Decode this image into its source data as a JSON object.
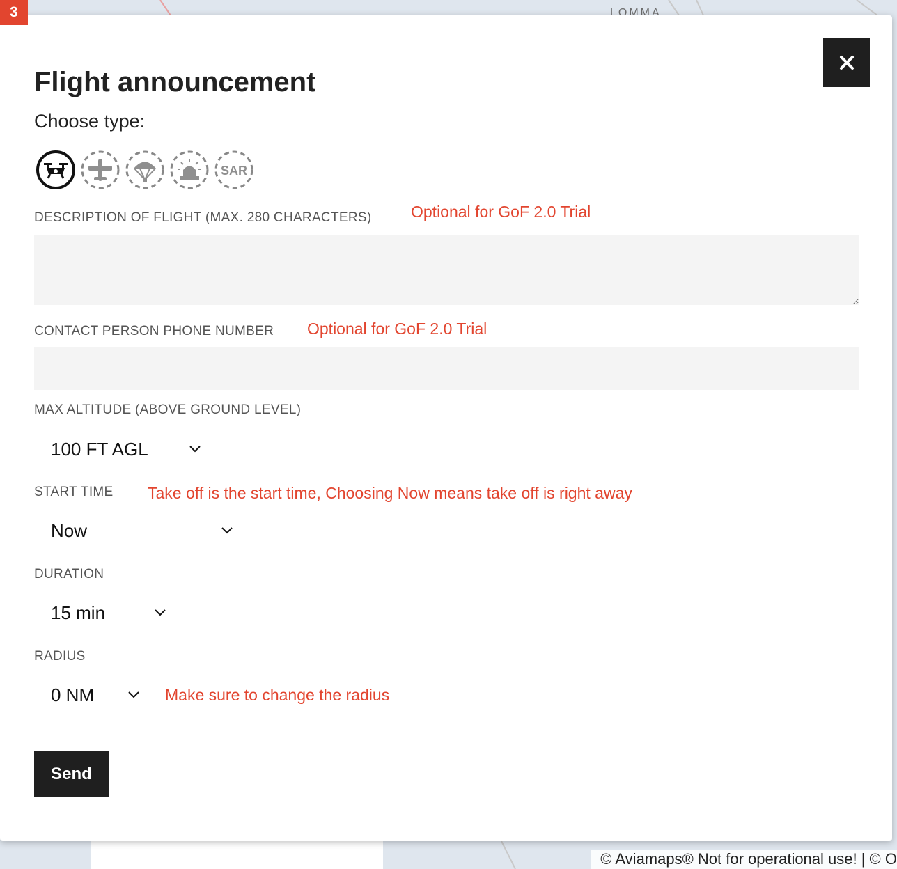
{
  "step_badge": "3",
  "map": {
    "place_label": "LOMMA",
    "attribution": "© Aviamaps® Not for operational use! | © O"
  },
  "modal": {
    "title": "Flight announcement",
    "close_icon": "close-icon",
    "choose_type_label": "Choose type:",
    "types": [
      {
        "icon": "drone-icon",
        "selected": true
      },
      {
        "icon": "airplane-icon",
        "selected": false
      },
      {
        "icon": "parachute-icon",
        "selected": false
      },
      {
        "icon": "emergency-siren-icon",
        "selected": false
      },
      {
        "icon": "sar-icon",
        "label": "SAR",
        "selected": false
      }
    ],
    "description": {
      "label": "DESCRIPTION OF FLIGHT (MAX. 280 CHARACTERS)",
      "annotation": "Optional for GoF 2.0 Trial",
      "value": ""
    },
    "phone": {
      "label": "CONTACT PERSON PHONE NUMBER",
      "annotation": "Optional for GoF 2.0 Trial",
      "value": ""
    },
    "max_altitude": {
      "label": "MAX ALTITUDE (ABOVE GROUND LEVEL)",
      "value": "100 FT AGL"
    },
    "start_time": {
      "label": "START TIME",
      "annotation": "Take off is the start time, Choosing Now means take off is right away",
      "value": "Now"
    },
    "duration": {
      "label": "DURATION",
      "value": "15 min"
    },
    "radius": {
      "label": "RADIUS",
      "annotation": "Make sure to change the radius",
      "value": "0 NM"
    },
    "send_label": "Send"
  },
  "colors": {
    "annotation": "#e2452f",
    "badge": "#e2452f",
    "button_bg": "#1f1f1f"
  }
}
